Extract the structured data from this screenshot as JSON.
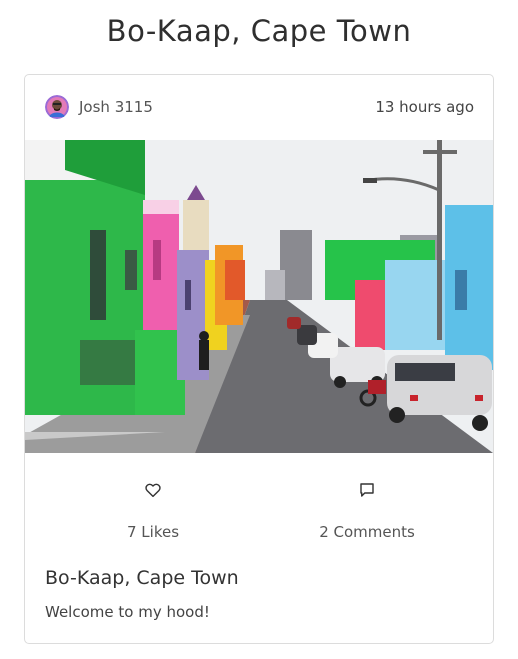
{
  "page": {
    "title": "Bo-Kaap, Cape Town"
  },
  "post": {
    "author": "Josh 3115",
    "timestamp": "13 hours ago",
    "avatar_icon": "user-avatar",
    "image_description": "photo",
    "likes_label": "7 Likes",
    "comments_label": "2 Comments",
    "like_icon": "heart-icon",
    "comment_icon": "comment-bubble-icon",
    "title": "Bo-Kaap, Cape Town",
    "body": "Welcome to my hood!"
  },
  "colors": {
    "border": "#dcdcdc",
    "text": "#333333",
    "muted": "#555555"
  }
}
